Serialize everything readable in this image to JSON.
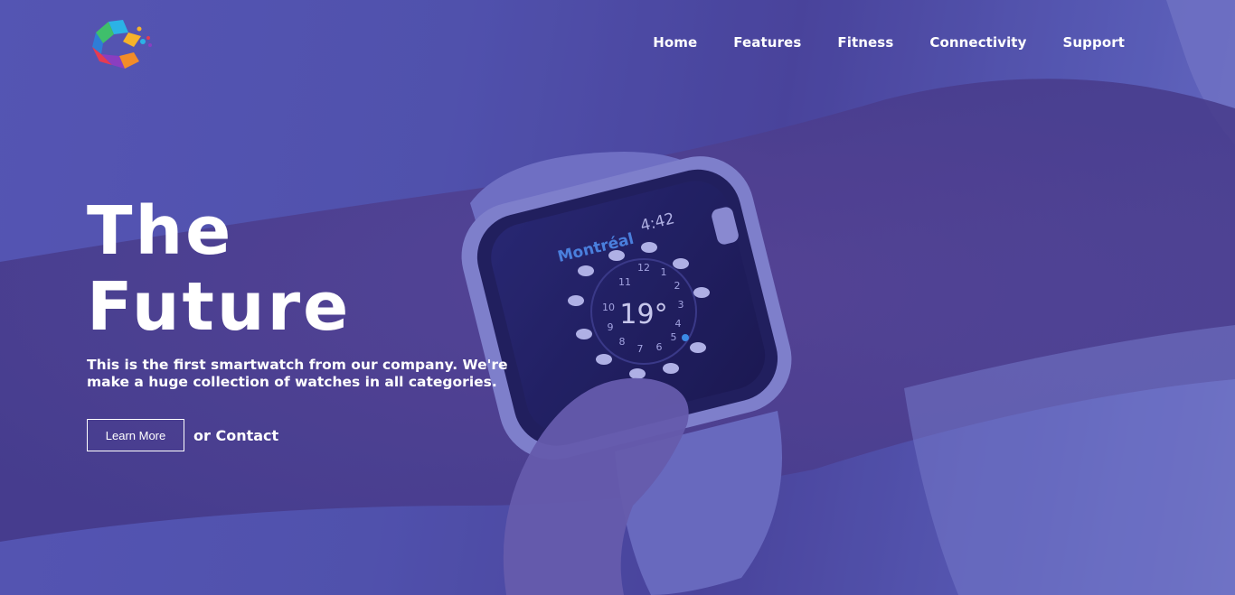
{
  "brand": {
    "logo_icon": "colorful-hexagon-logo-icon"
  },
  "nav": {
    "items": [
      {
        "label": "Home"
      },
      {
        "label": "Features"
      },
      {
        "label": "Fitness"
      },
      {
        "label": "Connectivity"
      },
      {
        "label": "Support"
      }
    ]
  },
  "hero": {
    "title_line1": "The",
    "title_line2": "Future",
    "description": "This is the first smartwatch from our company. We're make a huge collection of watches in all categories.",
    "learn_more_label": "Learn More",
    "or_text": "or",
    "contact_label": "Contact"
  },
  "watch": {
    "city": "Montréal",
    "time": "4:42",
    "temperature": "19°",
    "dial_numbers": [
      "12",
      "1",
      "2",
      "3",
      "4",
      "5",
      "6",
      "7",
      "8",
      "9",
      "10",
      "11"
    ]
  },
  "colors": {
    "overlay": "#5557ad",
    "text": "#ffffff"
  }
}
